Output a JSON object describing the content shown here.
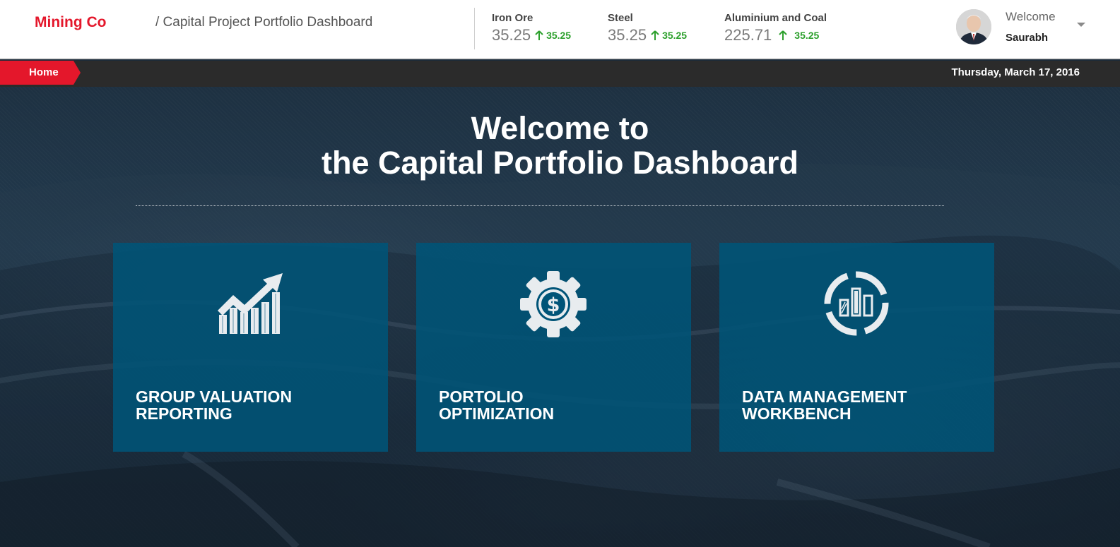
{
  "header": {
    "brand": "Mining Co",
    "page_title": "/ Capital Project Portfolio Dashboard",
    "tickers": [
      {
        "name": "Iron Ore",
        "price": "35.25",
        "change": "35.25"
      },
      {
        "name": "Steel",
        "price": "35.25",
        "change": "35.25"
      },
      {
        "name": "Aluminium and Coal",
        "price": "225.71",
        "change": "35.25"
      }
    ],
    "user": {
      "welcome": "Welcome",
      "name": "Saurabh"
    }
  },
  "nav": {
    "home_label": "Home",
    "date": "Thursday, March 17, 2016"
  },
  "hero": {
    "title_line1": "Welcome to",
    "title_line2": "the Capital Portfolio Dashboard"
  },
  "tiles": [
    {
      "line1": "GROUP VALUATION",
      "line2": "REPORTING",
      "icon": "growth-chart-icon"
    },
    {
      "line1": "PORTOLIO",
      "line2": "OPTIMIZATION",
      "icon": "dollar-gear-icon"
    },
    {
      "line1": "DATA MANAGEMENT",
      "line2": "WORKBENCH",
      "icon": "donut-bar-chart-icon"
    }
  ],
  "colors": {
    "brand_red": "#e4172b",
    "positive_green": "#2ca02c",
    "tile_blue": "#005478",
    "navbar_dark": "#2b2b2b"
  }
}
